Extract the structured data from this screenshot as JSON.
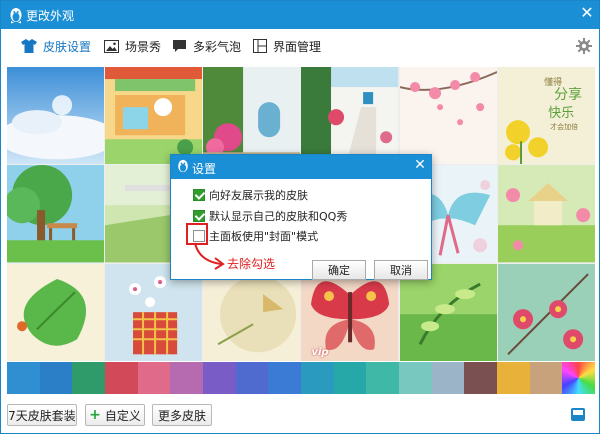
{
  "window": {
    "title": "更改外观"
  },
  "tabs": [
    {
      "label": "皮肤设置",
      "icon": "shirt-icon",
      "active": true
    },
    {
      "label": "场景秀",
      "icon": "image-icon",
      "active": false
    },
    {
      "label": "多彩气泡",
      "icon": "bubble-icon",
      "active": false
    },
    {
      "label": "界面管理",
      "icon": "layout-icon",
      "active": false
    }
  ],
  "skins": [
    {
      "theme": "sky",
      "vip": false
    },
    {
      "theme": "cartoon-shop",
      "vip": false
    },
    {
      "theme": "flower-alley",
      "vip": false
    },
    {
      "theme": "seaside-stairs",
      "vip": false
    },
    {
      "theme": "cherry-blossom",
      "vip": false
    },
    {
      "theme": "share-happiness",
      "text": "懂得分享 快乐才会加倍",
      "vip": false
    },
    {
      "theme": "tree-bench",
      "vip": false
    },
    {
      "theme": "field",
      "vip": false
    },
    {
      "theme": "beige",
      "vip": false
    },
    {
      "theme": "stripes",
      "vip": false
    },
    {
      "theme": "ribbon-heart",
      "vip": false
    },
    {
      "theme": "green-pavilion",
      "vip": false
    },
    {
      "theme": "green-leaf",
      "vip": false
    },
    {
      "theme": "flower-cup",
      "vip": false
    },
    {
      "theme": "paper-bird",
      "vip": false
    },
    {
      "theme": "butterfly",
      "vip": true
    },
    {
      "theme": "green-sprout",
      "vip": false
    },
    {
      "theme": "pink-flowers",
      "vip": false
    }
  ],
  "vip_label": "vip",
  "swatches": [
    "#2f8fd1",
    "#2a7fc6",
    "#2f9b6b",
    "#d24a5a",
    "#e06a8a",
    "#b66ab0",
    "#7a5cc6",
    "#4f6bcf",
    "#3b7bd5",
    "#2a9bbf",
    "#27a8a8",
    "#3fb8a8",
    "#78c8c0",
    "#9cb4c8",
    "#7a5050",
    "#e8b23a",
    "#c8a27a",
    "#rainbow"
  ],
  "footer": {
    "suit_button": "7天皮肤套装",
    "custom_button": "自定义",
    "more_button": "更多皮肤"
  },
  "dialog": {
    "title": "设置",
    "options": [
      {
        "label": "向好友展示我的皮肤",
        "checked": true
      },
      {
        "label": "默认显示自己的皮肤和QQ秀",
        "checked": true
      },
      {
        "label": "主面板使用\"封面\"模式",
        "checked": false
      }
    ],
    "ok_button": "确定",
    "cancel_button": "取消"
  },
  "annotation": {
    "text": "去除勾选",
    "color": "#e02020"
  },
  "colors": {
    "accent": "#1a8fd6",
    "check": "#2f9e2f"
  }
}
